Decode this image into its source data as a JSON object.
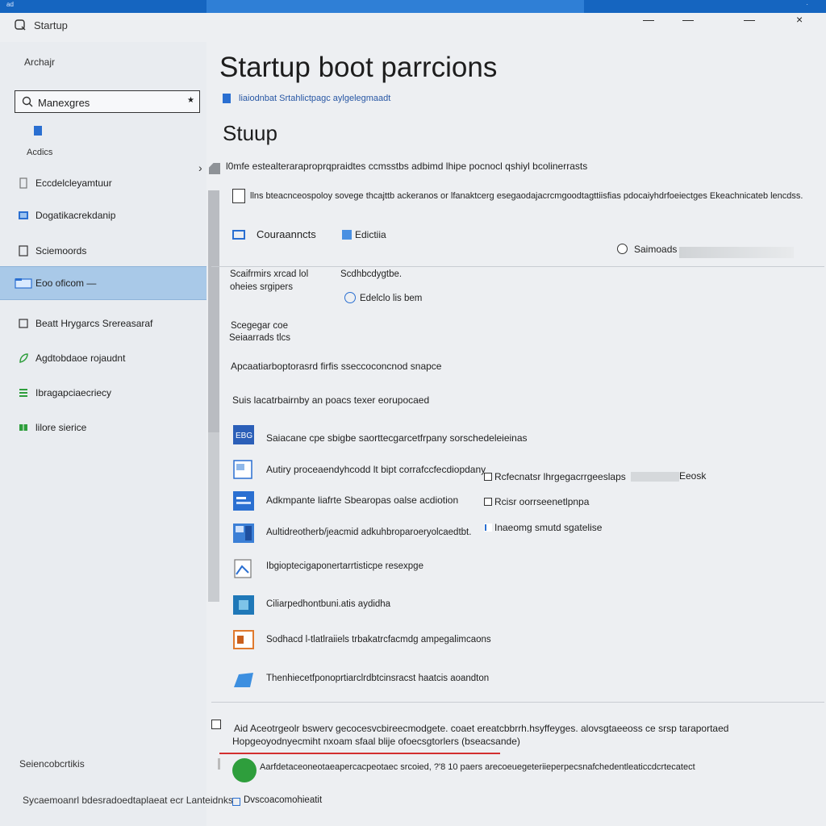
{
  "window": {
    "corner_label": "ad",
    "app_title": "Startup boot parrcions",
    "controls": {
      "minimize": "—",
      "maximize": "—",
      "restore": "—",
      "close": "×"
    },
    "tab_title": "Startup"
  },
  "sidebar": {
    "header": "Archajr",
    "search": {
      "value": "Manexgres",
      "placeholder": "Manexgres"
    },
    "sub_label": "Acdics",
    "items": [
      {
        "label": "Eccdelcleyamtuur",
        "icon": "file-icon"
      },
      {
        "label": "Dogatikacrekdanip",
        "icon": "monitor-icon"
      },
      {
        "label": "Sciemoords",
        "icon": "document-icon"
      },
      {
        "label": "Eoo oficom —",
        "icon": "folder-icon",
        "active": true
      },
      {
        "label": "Beatt Hrygarcs Srereasaraf",
        "icon": "window-icon"
      },
      {
        "label": "Agdtobdaoe rojaudnt",
        "icon": "leaf-icon"
      },
      {
        "label": "Ibragapciaecriecy",
        "icon": "layers-icon"
      },
      {
        "label": "lilore sierice",
        "icon": "grid-icon"
      }
    ],
    "footer1": "Seiencobcrtikis",
    "footer2": "Sycaemoanrl bdesradoedtaplaeat ecr Lanteidnks"
  },
  "main": {
    "breadcrumb": "liaiodnbat Srtahlictpagc aylgelegmaadt",
    "section_heading": "Stuup",
    "info_text": "l0mfe estealteraraproprqpraidtes ccmsstbs adbimd lhipe pocnocl qshiyl bcolinerrasts",
    "checkbox_text": "llns bteacnceospoloy sovege thcajttb ackeranos or lfanaktcerg esegaodajacrcmgoodtagttiisfias pdocaiyhdrfoeiectges Ekeachnicateb lencdss.",
    "toolbar": {
      "item1": "Couraanncts",
      "item2": "Edictiia",
      "radio": "Saimoads"
    },
    "fields": {
      "left_label": "Scaifrmirs xrcad lol",
      "left_label2": "oheies srgipers",
      "right_label": "Scdhbcdygtbe.",
      "link": "Edelclo lis bem",
      "label3": "Scegegar coe",
      "label4": "Seiaarrads tlcs",
      "long1": "Apcaatiarboptorasrd firfis sseccoconcnod snapce",
      "long2": "Suis lacatrbairnby an poacs texer eorupocaed"
    },
    "apps": [
      {
        "label": "Saiacane cpe sbigbe saorttecgarcetfrpany sorschedeleieinas",
        "icon": "app-badge-icon"
      },
      {
        "label": "Autiry proceaendyhcodd lt bipt corrafccfecdiopdany",
        "icon": "app-window-icon"
      },
      {
        "label": "Adkmpante liafrte Sbearopas oalse acdiotion",
        "icon": "app-blue-icon"
      },
      {
        "label": "Aultidreotherb/jeacmid adkuhbroparoeryolcaedtbt.",
        "icon": "app-panel-icon"
      },
      {
        "label": "Ibgioptecigaponertarrtisticpe resexpge",
        "icon": "app-doc-icon"
      },
      {
        "label": "Ciliarpedhontbuni.atis aydidha",
        "icon": "app-teal-icon"
      },
      {
        "label": "Sodhacd l-tlatlraiiels trbakatrcfacmdg ampegalimcaons",
        "icon": "app-orange-icon"
      },
      {
        "label": "Thenhiecetfponoprtiarclrdbtcinsracst haatcis aoandton",
        "icon": "app-cloud-icon"
      }
    ],
    "options": [
      {
        "label": "Rcfecnatsr lhrgegacrrgeeslaps",
        "icon": "checkbox-icon",
        "side": "Eeosk"
      },
      {
        "label": "Rcisr oorrseenetlpnpa",
        "icon": "checkbox-icon"
      },
      {
        "label": "Inaeomg smutd sgatelise",
        "icon": "list-icon"
      }
    ],
    "footer": {
      "line1": "Aid Aceotrgeolr bswerv gecocesvcbireecmodgete. coaet ereatcbbrrh.hsyffeyges. alovsgtaeeoss ce srsp taraportaed",
      "line2": "Hopgeoyodnyecmiht nxoam sfaal blije ofoecsgtorlers (bseacsande)",
      "line3": "Aarfdetaceoneotaeapercacpeotaec srcoied, ?'8 10 paers arecoeuegeteriieperpecsnafchedentleaticcdcrtecatect",
      "line4": "Dvscoacomohieatit"
    }
  },
  "colors": {
    "accent": "#1565c0",
    "active_item": "#a9c9e8",
    "link": "#2a6fd1",
    "warning_underline": "#d32f2f"
  }
}
